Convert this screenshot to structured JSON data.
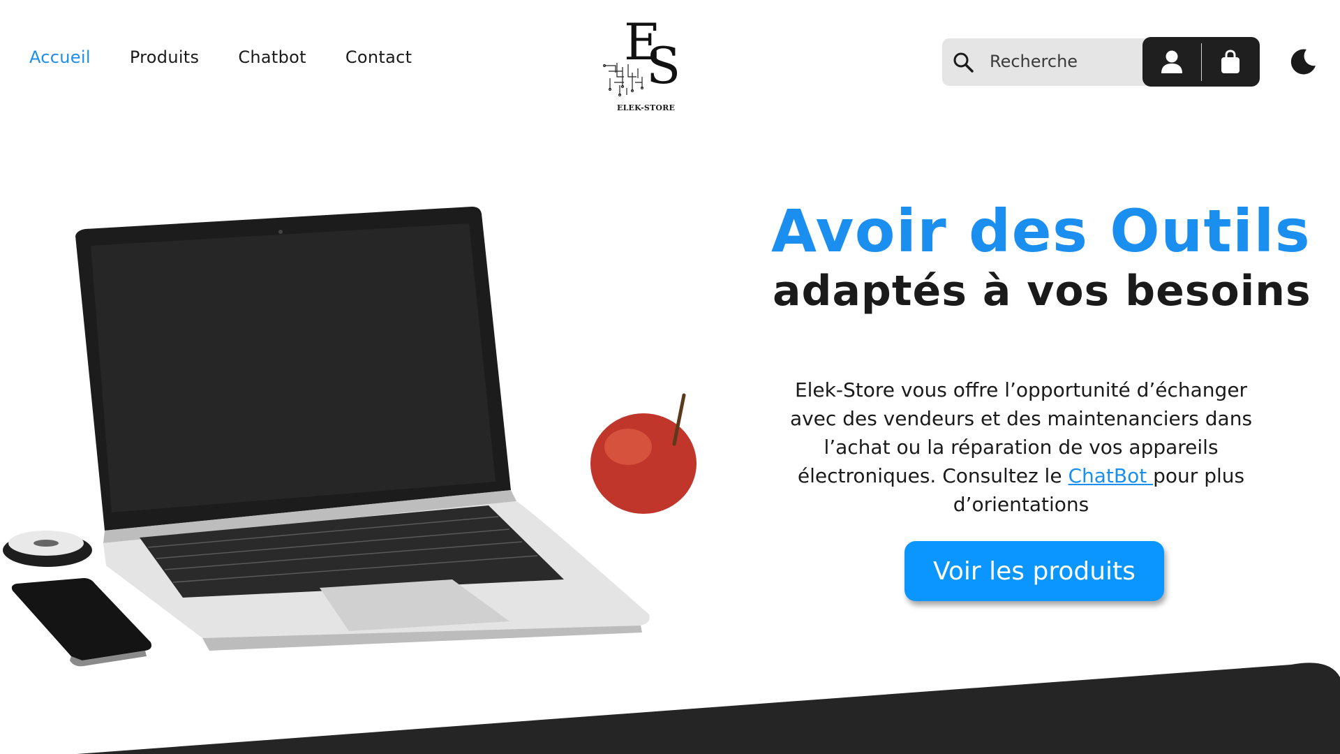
{
  "nav": {
    "items": [
      {
        "label": "Accueil",
        "active": true
      },
      {
        "label": "Produits",
        "active": false
      },
      {
        "label": "Chatbot",
        "active": false
      },
      {
        "label": "Contact",
        "active": false
      }
    ]
  },
  "logo": {
    "letters_e": "E",
    "letters_s": "S",
    "brand": "ELEK-STORE"
  },
  "search": {
    "placeholder": "Recherche"
  },
  "header_icons": {
    "user_icon": "user-icon",
    "bag_icon": "shopping-bag-icon",
    "theme_icon": "moon-icon"
  },
  "hero": {
    "title_line1": "Avoir des Outils",
    "title_line2": "adaptés à vos besoins",
    "description_before_link": "Elek-Store vous offre l’opportunité d’échanger avec des vendeurs et des maintenanciers dans l’achat ou la réparation de vos appareils électroniques. Consultez le ",
    "description_link": "ChatBot ",
    "description_after_link": "pour plus d’orientations",
    "cta_label": "Voir les produits"
  },
  "colors": {
    "accent": "#1b8ff0",
    "cta": "#0b96ff",
    "dark": "#1f1f1f",
    "bottom_band": "#252525"
  }
}
